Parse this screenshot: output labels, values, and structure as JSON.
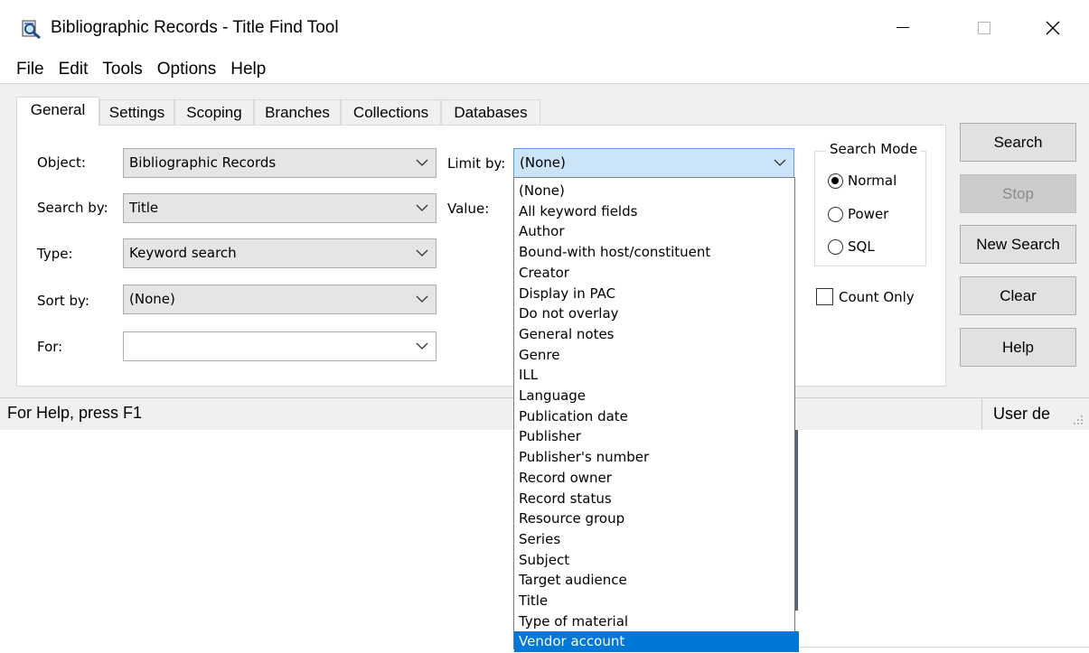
{
  "window": {
    "title": "Bibliographic Records - Title Find Tool",
    "icon": "search-magnifier-icon"
  },
  "menu": [
    "File",
    "Edit",
    "Tools",
    "Options",
    "Help"
  ],
  "tabs": [
    "General",
    "Settings",
    "Scoping",
    "Branches",
    "Collections",
    "Databases"
  ],
  "form": {
    "object_label": "Object:",
    "object_value": "Bibliographic Records",
    "searchby_label": "Search by:",
    "searchby_value": "Title",
    "type_label": "Type:",
    "type_value": "Keyword search",
    "sortby_label": "Sort by:",
    "sortby_value": "(None)",
    "for_label": "For:",
    "for_value": "",
    "limitby_label": "Limit by:",
    "limitby_value": "(None)",
    "value_label": "Value:"
  },
  "search_mode": {
    "legend": "Search Mode",
    "options": [
      "Normal",
      "Power",
      "SQL"
    ],
    "selected": "Normal"
  },
  "count_only": {
    "label": "Count Only",
    "checked": false
  },
  "buttons": {
    "search": "Search",
    "stop": "Stop",
    "new_search": "New Search",
    "clear": "Clear",
    "help": "Help"
  },
  "status": {
    "help_text": "For Help, press F1",
    "user_text": "User de"
  },
  "limit_options": [
    "(None)",
    "All keyword fields",
    "Author",
    "Bound-with host/constituent",
    "Creator",
    "Display in PAC",
    "Do not overlay",
    "General notes",
    "Genre",
    "ILL",
    "Language",
    "Publication date",
    "Publisher",
    "Publisher's number",
    "Record owner",
    "Record status",
    "Resource group",
    "Series",
    "Subject",
    "Target audience",
    "Title",
    "Type of material",
    "Vendor account"
  ],
  "limit_selected_index": 22
}
